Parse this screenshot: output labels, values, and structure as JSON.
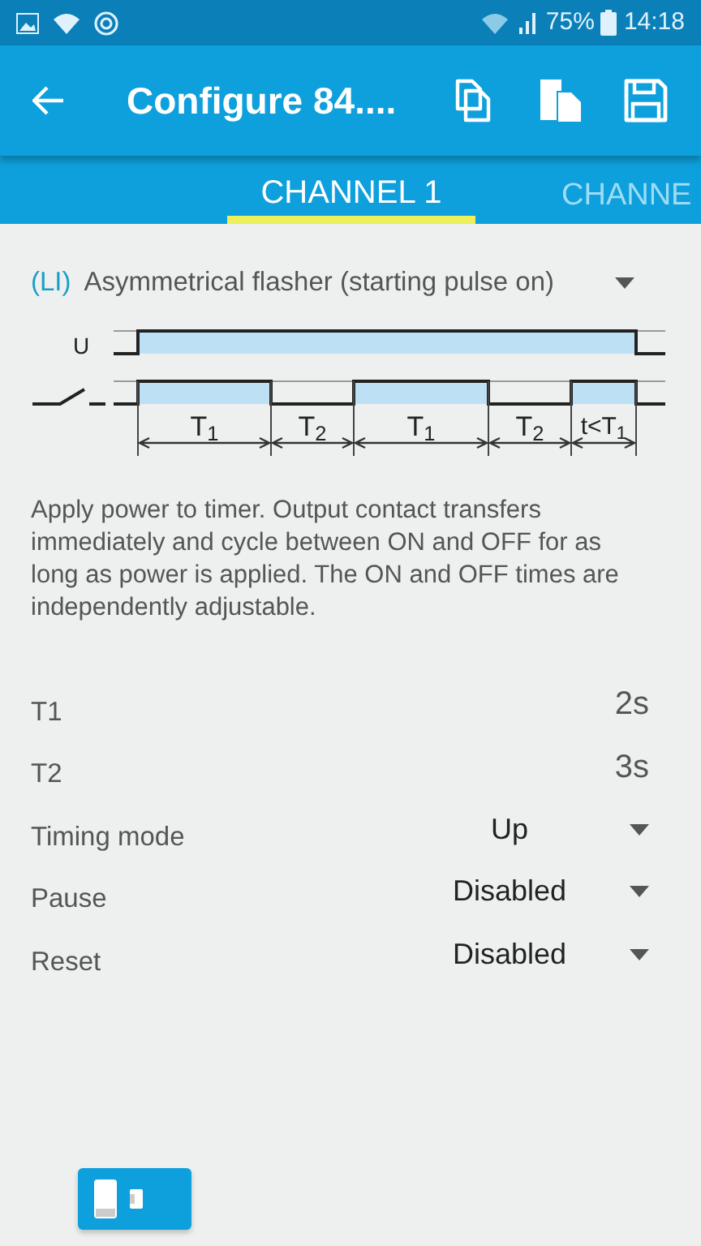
{
  "status_bar": {
    "battery": "75%",
    "time": "14:18"
  },
  "app_bar": {
    "title": "Configure 84...."
  },
  "tabs": [
    {
      "label": "CHANNEL 1",
      "selected": true
    },
    {
      "label": "CHANNE",
      "selected": false
    }
  ],
  "function": {
    "code": "(LI)",
    "name": "Asymmetrical flasher (starting pulse on)"
  },
  "diagram": {
    "supply_label": "U",
    "intervals": [
      "T$_{1}$",
      "T$_{2}$",
      "T$_{1}$",
      "T$_{2}$",
      "t<T$_{1}$"
    ]
  },
  "description": "Apply power to timer. Output contact transfers immediately and cycle between ON and OFF for as long as power is applied. The ON and OFF times are independently adjustable.",
  "settings": [
    {
      "kind": "value",
      "label": "T1",
      "value": "2s"
    },
    {
      "kind": "value",
      "label": "T2",
      "value": "3s"
    },
    {
      "kind": "dropdown",
      "label": "Timing mode",
      "value": "Up"
    },
    {
      "kind": "dropdown",
      "label": "Pause",
      "value": "Disabled"
    },
    {
      "kind": "dropdown",
      "label": "Reset",
      "value": "Disabled"
    }
  ]
}
